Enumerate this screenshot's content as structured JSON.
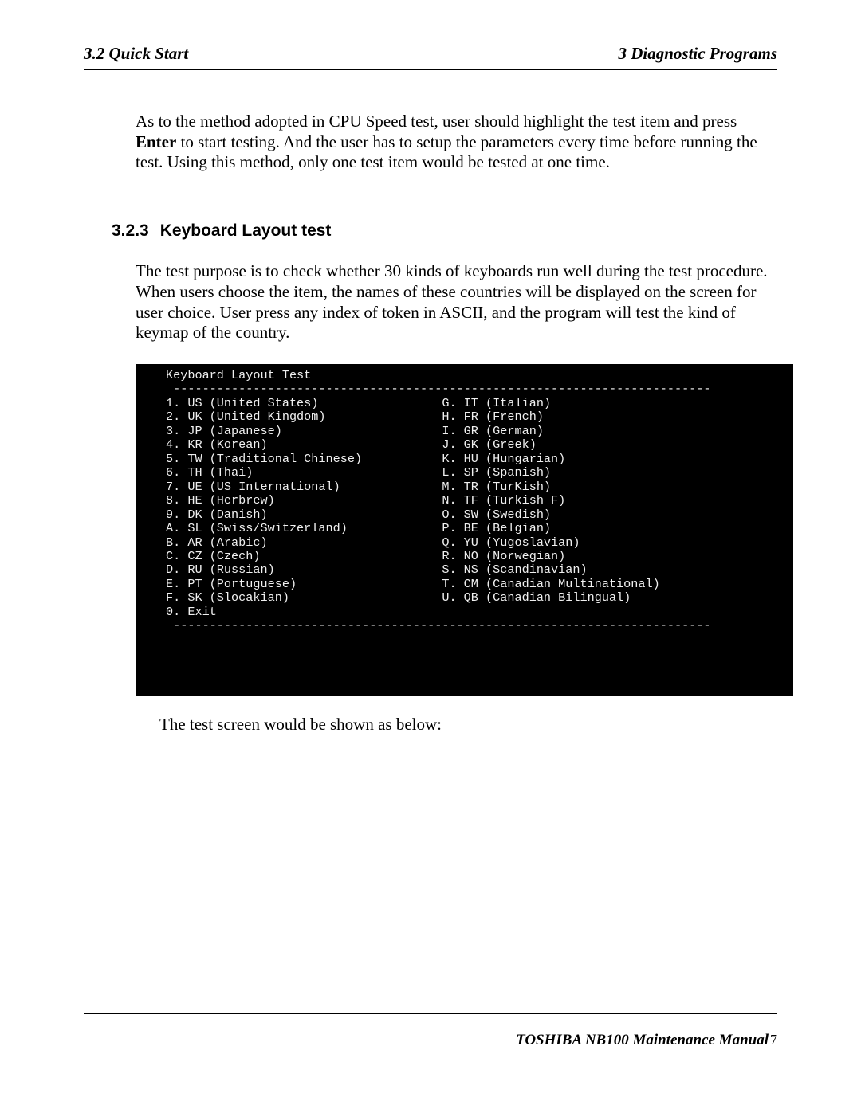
{
  "header": {
    "left": "3.2 Quick Start",
    "right": "3  Diagnostic Programs"
  },
  "intro": {
    "pre": "As to the method adopted in CPU Speed test, user should highlight the test item and press ",
    "bold": "Enter",
    "post": " to start testing. And the user has to setup the parameters every time before running the test. Using this method, only one test item would be tested at one time."
  },
  "section": {
    "number": "3.2.3",
    "title": "Keyboard Layout test",
    "para": "The test purpose is to check whether 30 kinds of keyboards run well during the test procedure. When users choose the item, the names of these countries will be displayed on the screen for user choice. User press any index of token in ASCII, and the program will test the kind of keymap of the country."
  },
  "terminal": {
    "title": "Keyboard Layout Test",
    "rule": "--------------------------------------------------------------------------",
    "left": [
      "1. US (United States)",
      "2. UK (United Kingdom)",
      "3. JP (Japanese)",
      "4. KR (Korean)",
      "5. TW (Traditional Chinese)",
      "6. TH (Thai)",
      "7. UE (US International)",
      "8. HE (Herbrew)",
      "9. DK (Danish)",
      "A. SL (Swiss/Switzerland)",
      "B. AR (Arabic)",
      "C. CZ (Czech)",
      "D. RU (Russian)",
      "E. PT (Portuguese)",
      "F. SK (Slocakian)",
      "0. Exit"
    ],
    "right": [
      "G. IT (Italian)",
      "H. FR (French)",
      "I. GR (German)",
      "J. GK (Greek)",
      "K. HU (Hungarian)",
      "L. SP (Spanish)",
      "M. TR (TurKish)",
      "N. TF (Turkish F)",
      "O. SW (Swedish)",
      "P. BE (Belgian)",
      "Q. YU (Yugoslavian)",
      "R. NO (Norwegian)",
      "S. NS (Scandinavian)",
      "T. CM (Canadian Multinational)",
      "U. QB (Canadian Bilingual)"
    ],
    "col1_width": 38
  },
  "after_terminal": "The test screen would be shown as below:",
  "footer": {
    "bold": "TOSHIBA NB100 Maintenance Manual",
    "page": "7"
  }
}
